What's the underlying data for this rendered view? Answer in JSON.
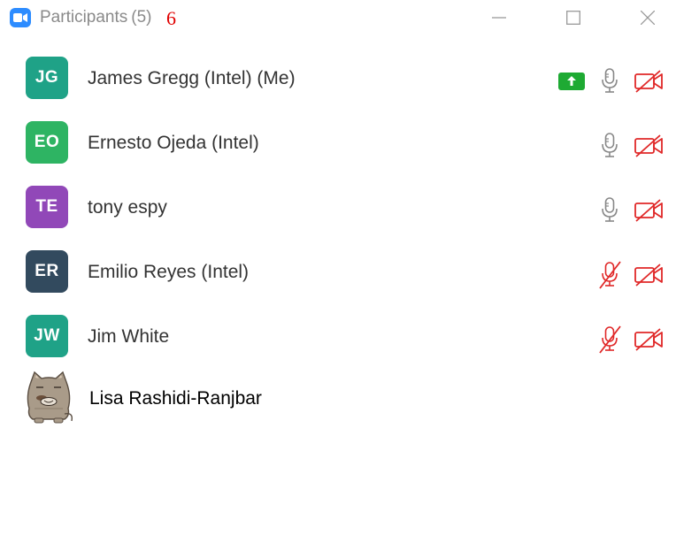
{
  "window": {
    "title": "Participants",
    "count": "(5)",
    "annotation": "6",
    "controls": [
      "minimize",
      "maximize",
      "close"
    ]
  },
  "colors": {
    "accent": "#2D8CFF",
    "muted_red": "#E02828",
    "share_green": "#1EAA33",
    "icon_gray": "#888888"
  },
  "participants": [
    {
      "initials": "JG",
      "name": "James Gregg (Intel) (Me)",
      "avatar_color": "#1FA287",
      "sharing": true,
      "mic": "on",
      "video": "off"
    },
    {
      "initials": "EO",
      "name": "Ernesto Ojeda (Intel)",
      "avatar_color": "#2EB463",
      "sharing": false,
      "mic": "on",
      "video": "off"
    },
    {
      "initials": "TE",
      "name": "tony espy",
      "avatar_color": "#9148B8",
      "sharing": false,
      "mic": "on",
      "video": "off"
    },
    {
      "initials": "ER",
      "name": "Emilio Reyes (Intel)",
      "avatar_color": "#324A5E",
      "sharing": false,
      "mic": "muted",
      "video": "off"
    },
    {
      "initials": "JW",
      "name": "Jim White",
      "avatar_color": "#1FA287",
      "sharing": false,
      "mic": "muted",
      "video": "off"
    },
    {
      "initials": "",
      "name": "Lisa Rashidi-Ranjbar",
      "avatar_image": "cat-sticker",
      "sharing": false,
      "mic": "",
      "video": ""
    }
  ]
}
